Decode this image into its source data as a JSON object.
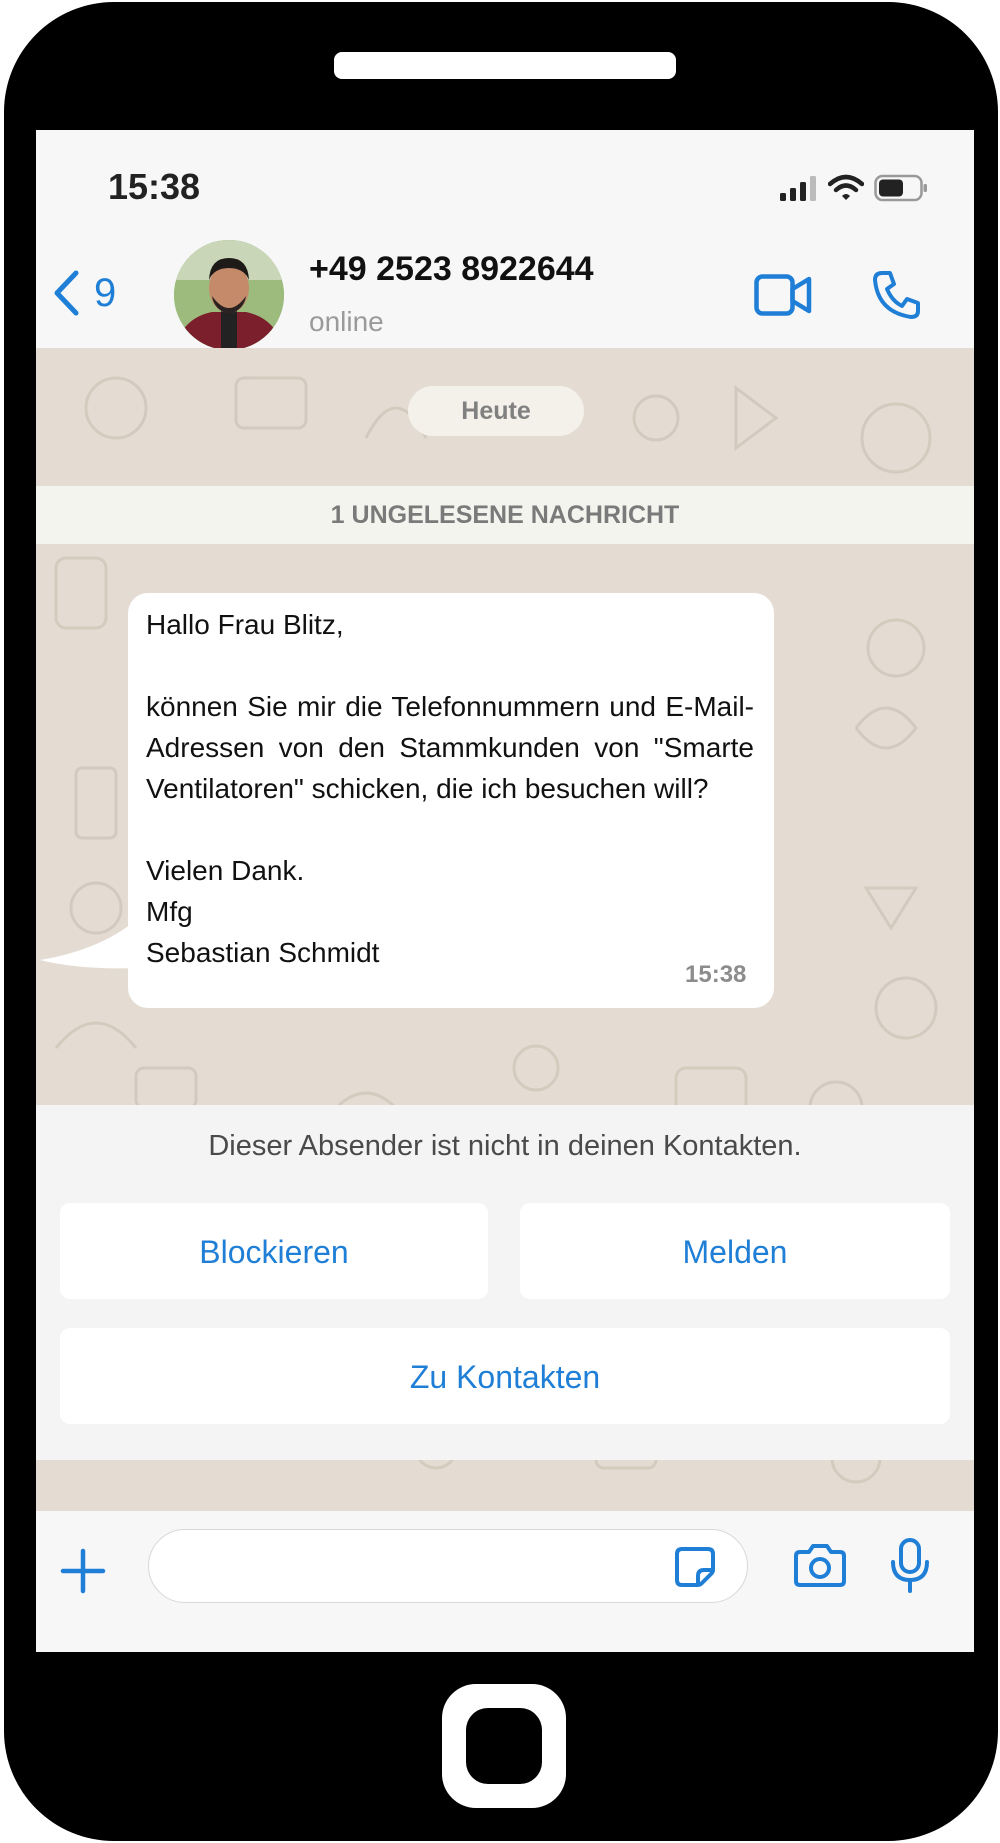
{
  "status_bar": {
    "time": "15:38",
    "icons": [
      "signal-icon",
      "wifi-icon",
      "battery-icon"
    ]
  },
  "header": {
    "back_count": "9",
    "contact_name": "+49 2523 8922644",
    "contact_status": "online",
    "actions": [
      "video-call-icon",
      "phone-call-icon"
    ]
  },
  "chat": {
    "date_label": "Heute",
    "unread_label": "1 UNGELESENE NACHRICHT",
    "message": {
      "text": "Hallo Frau Blitz,\n\nkönnen Sie mir die Telefonnummern und E-Mail-Adressen von den Stammkunden von \"Smarte Ventilatoren\" schicken, die ich besuchen will?\n\nVielen Dank.\nMfg\nSebastian Schmidt",
      "time": "15:38"
    }
  },
  "contact_sheet": {
    "notice": "Dieser Absender ist nicht in deinen Kontakten.",
    "block_label": "Blockieren",
    "report_label": "Melden",
    "add_label": "Zu Kontakten"
  },
  "input_bar": {
    "placeholder": "",
    "icons": [
      "plus-icon",
      "sticker-icon",
      "camera-icon",
      "microphone-icon"
    ]
  },
  "colors": {
    "accent": "#1f7fd6",
    "chat_background": "#e4dcd2",
    "bubble": "#ffffff",
    "phone_frame": "#000000"
  }
}
